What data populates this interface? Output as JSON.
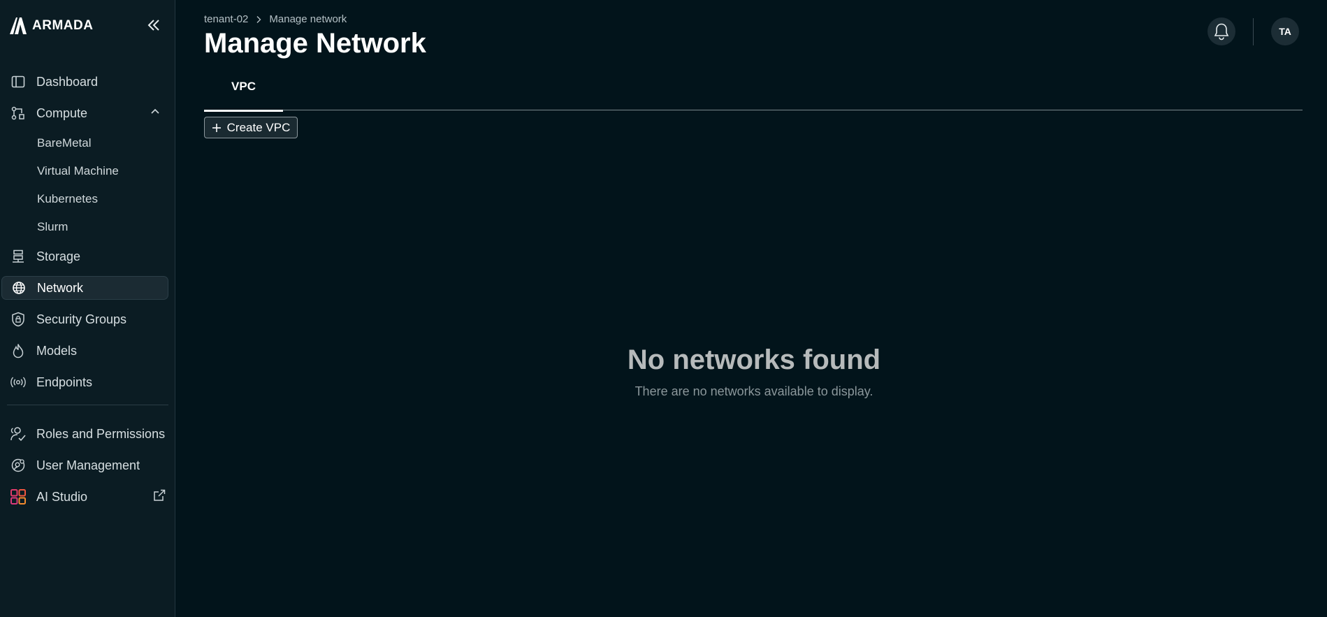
{
  "brand": {
    "name": "ARMADA"
  },
  "sidebar": {
    "items": [
      {
        "label": "Dashboard",
        "icon": "dashboard-icon"
      },
      {
        "label": "Compute",
        "icon": "compute-icon",
        "expanded": true,
        "children": [
          "BareMetal",
          "Virtual Machine",
          "Kubernetes",
          "Slurm"
        ]
      },
      {
        "label": "Storage",
        "icon": "storage-icon"
      },
      {
        "label": "Network",
        "icon": "globe-icon",
        "active": true
      },
      {
        "label": "Security Groups",
        "icon": "shield-lock-icon"
      },
      {
        "label": "Models",
        "icon": "flame-icon"
      },
      {
        "label": "Endpoints",
        "icon": "broadcast-icon"
      }
    ],
    "bottom_items": [
      {
        "label": "Roles and Permissions",
        "icon": "users-check-icon"
      },
      {
        "label": "User Management",
        "icon": "user-gear-icon"
      },
      {
        "label": "AI Studio",
        "icon": "grid-icon",
        "external": true
      }
    ]
  },
  "breadcrumb": {
    "parent": "tenant-02",
    "current": "Manage network"
  },
  "header": {
    "title": "Manage Network",
    "avatar_initials": "TA"
  },
  "tabs": [
    {
      "label": "VPC",
      "active": true
    }
  ],
  "actions": {
    "create_label": "Create VPC"
  },
  "empty_state": {
    "title": "No networks found",
    "subtitle": "There are no networks available to display."
  },
  "colors": {
    "background": "#02141b",
    "sidebar": "#0b1c23",
    "active_item": "#1b2b33",
    "brand_grid": [
      "#e23b6b",
      "#f28a2e"
    ]
  }
}
